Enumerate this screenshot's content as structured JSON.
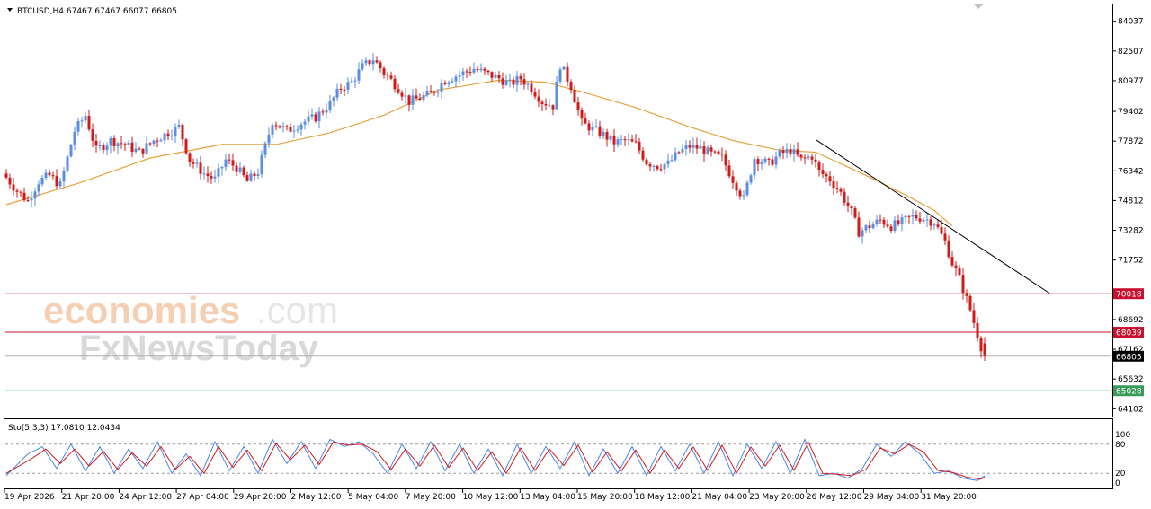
{
  "header": {
    "symbol_line": "BTCUSD,H4  67467 67467 66077 66805"
  },
  "watermark": {
    "brand_a": "economies",
    "brand_b": ".com",
    "brand_c": "FxNewsToday"
  },
  "stoch": {
    "label": "Sto(5,3,3) 17.0810 12.0434",
    "levels": [
      "100",
      "80",
      "20",
      "0"
    ]
  },
  "colors": {
    "bull": "#5b8ee0",
    "bear": "#d11a1a",
    "ma": "#e6a23c",
    "resistance": "#c8102e",
    "support": "#3a9a5b",
    "last_price": "#000000"
  },
  "chart_data": {
    "type": "candlestick",
    "title": "",
    "y_ticks": [
      84037,
      82507,
      80977,
      79402,
      77872,
      76342,
      74812,
      73282,
      71752,
      68692,
      67162,
      65632,
      64102
    ],
    "x_ticks": [
      "19 Apr 2026",
      "21 Apr 20:00",
      "24 Apr 12:00",
      "27 Apr 04:00",
      "29 Apr 20:00",
      "2 May 12:00",
      "5 May 04:00",
      "7 May 20:00",
      "10 May 12:00",
      "13 May 04:00",
      "15 May 20:00",
      "18 May 12:00",
      "21 May 04:00",
      "23 May 20:00",
      "26 May 12:00",
      "29 May 04:00",
      "31 May 20:00"
    ],
    "ylim": [
      63700,
      84900
    ],
    "price_labels": [
      {
        "label": "70018",
        "value": 70018,
        "kind": "resistance"
      },
      {
        "label": "68039",
        "value": 68039,
        "kind": "resistance"
      },
      {
        "label": "66805",
        "value": 66805,
        "kind": "last"
      },
      {
        "label": "65028",
        "value": 65028,
        "kind": "support"
      }
    ],
    "trendline": {
      "from": {
        "bar": 225,
        "price": 77950
      },
      "to": {
        "bar": 290,
        "price": 70050
      }
    },
    "close_path": [
      [
        0,
        76000
      ],
      [
        3,
        75300
      ],
      [
        6,
        74800
      ],
      [
        9,
        75800
      ],
      [
        12,
        76100
      ],
      [
        15,
        75600
      ],
      [
        19,
        78400
      ],
      [
        22,
        79200
      ],
      [
        25,
        77400
      ],
      [
        29,
        77900
      ],
      [
        33,
        77700
      ],
      [
        37,
        77300
      ],
      [
        41,
        77900
      ],
      [
        45,
        78300
      ],
      [
        48,
        78600
      ],
      [
        51,
        76900
      ],
      [
        55,
        76200
      ],
      [
        58,
        75900
      ],
      [
        61,
        76900
      ],
      [
        64,
        76500
      ],
      [
        67,
        75800
      ],
      [
        70,
        76300
      ],
      [
        74,
        78900
      ],
      [
        78,
        78400
      ],
      [
        82,
        78800
      ],
      [
        86,
        79100
      ],
      [
        90,
        79800
      ],
      [
        93,
        80600
      ],
      [
        96,
        80900
      ],
      [
        99,
        81700
      ],
      [
        102,
        82100
      ],
      [
        105,
        81400
      ],
      [
        109,
        80600
      ],
      [
        112,
        79900
      ],
      [
        115,
        80100
      ],
      [
        118,
        80300
      ],
      [
        122,
        81000
      ],
      [
        126,
        81300
      ],
      [
        130,
        81600
      ],
      [
        134,
        81300
      ],
      [
        137,
        81100
      ],
      [
        140,
        80800
      ],
      [
        143,
        81100
      ],
      [
        146,
        80600
      ],
      [
        149,
        79900
      ],
      [
        152,
        79700
      ],
      [
        154,
        81800
      ],
      [
        157,
        80700
      ],
      [
        160,
        78800
      ],
      [
        163,
        78500
      ],
      [
        166,
        78200
      ],
      [
        169,
        77800
      ],
      [
        172,
        77900
      ],
      [
        175,
        77700
      ],
      [
        178,
        76800
      ],
      [
        181,
        76600
      ],
      [
        184,
        76700
      ],
      [
        187,
        77300
      ],
      [
        190,
        77600
      ],
      [
        193,
        77500
      ],
      [
        196,
        77200
      ],
      [
        199,
        77000
      ],
      [
        202,
        75900
      ],
      [
        205,
        74900
      ],
      [
        208,
        77000
      ],
      [
        212,
        76700
      ],
      [
        215,
        77200
      ],
      [
        218,
        77400
      ],
      [
        221,
        76900
      ],
      [
        224,
        77100
      ],
      [
        226,
        76300
      ],
      [
        229,
        75900
      ],
      [
        232,
        75200
      ],
      [
        235,
        74200
      ],
      [
        237,
        73200
      ],
      [
        240,
        73500
      ],
      [
        243,
        73800
      ],
      [
        246,
        73500
      ],
      [
        249,
        73700
      ],
      [
        252,
        74000
      ],
      [
        255,
        73900
      ],
      [
        258,
        73700
      ],
      [
        261,
        72700
      ],
      [
        263,
        71600
      ],
      [
        265,
        70800
      ],
      [
        268,
        69200
      ],
      [
        270,
        67900
      ],
      [
        271,
        67300
      ],
      [
        272,
        66805
      ]
    ],
    "ma_path": [
      [
        0,
        74600
      ],
      [
        20,
        75700
      ],
      [
        40,
        77000
      ],
      [
        60,
        77700
      ],
      [
        75,
        77700
      ],
      [
        90,
        78300
      ],
      [
        105,
        79200
      ],
      [
        120,
        80500
      ],
      [
        137,
        81000
      ],
      [
        150,
        80900
      ],
      [
        162,
        80300
      ],
      [
        175,
        79600
      ],
      [
        190,
        78600
      ],
      [
        202,
        77900
      ],
      [
        215,
        77400
      ],
      [
        225,
        77300
      ],
      [
        238,
        76200
      ],
      [
        250,
        75100
      ],
      [
        258,
        74300
      ],
      [
        263,
        73500
      ]
    ],
    "stoch_k_path": [
      [
        0,
        15
      ],
      [
        6,
        60
      ],
      [
        10,
        75
      ],
      [
        14,
        30
      ],
      [
        18,
        80
      ],
      [
        22,
        25
      ],
      [
        26,
        75
      ],
      [
        30,
        20
      ],
      [
        34,
        70
      ],
      [
        38,
        30
      ],
      [
        42,
        85
      ],
      [
        46,
        20
      ],
      [
        50,
        60
      ],
      [
        54,
        15
      ],
      [
        58,
        85
      ],
      [
        62,
        25
      ],
      [
        66,
        75
      ],
      [
        70,
        20
      ],
      [
        74,
        90
      ],
      [
        78,
        40
      ],
      [
        82,
        85
      ],
      [
        86,
        30
      ],
      [
        90,
        90
      ],
      [
        94,
        75
      ],
      [
        98,
        85
      ],
      [
        102,
        60
      ],
      [
        106,
        20
      ],
      [
        110,
        80
      ],
      [
        114,
        30
      ],
      [
        118,
        85
      ],
      [
        122,
        25
      ],
      [
        126,
        80
      ],
      [
        130,
        20
      ],
      [
        134,
        70
      ],
      [
        138,
        15
      ],
      [
        142,
        80
      ],
      [
        146,
        20
      ],
      [
        150,
        75
      ],
      [
        154,
        30
      ],
      [
        158,
        85
      ],
      [
        162,
        15
      ],
      [
        166,
        70
      ],
      [
        170,
        20
      ],
      [
        174,
        75
      ],
      [
        178,
        15
      ],
      [
        182,
        75
      ],
      [
        186,
        25
      ],
      [
        190,
        80
      ],
      [
        194,
        20
      ],
      [
        198,
        85
      ],
      [
        202,
        15
      ],
      [
        206,
        80
      ],
      [
        210,
        30
      ],
      [
        214,
        85
      ],
      [
        218,
        20
      ],
      [
        222,
        90
      ],
      [
        226,
        15
      ],
      [
        230,
        20
      ],
      [
        234,
        10
      ],
      [
        238,
        30
      ],
      [
        242,
        80
      ],
      [
        246,
        55
      ],
      [
        250,
        85
      ],
      [
        254,
        60
      ],
      [
        258,
        20
      ],
      [
        262,
        25
      ],
      [
        266,
        10
      ],
      [
        270,
        5
      ],
      [
        272,
        15
      ]
    ],
    "stoch_d_path": [
      [
        0,
        20
      ],
      [
        7,
        50
      ],
      [
        11,
        70
      ],
      [
        15,
        40
      ],
      [
        19,
        70
      ],
      [
        23,
        35
      ],
      [
        27,
        65
      ],
      [
        31,
        28
      ],
      [
        35,
        62
      ],
      [
        39,
        35
      ],
      [
        43,
        75
      ],
      [
        47,
        28
      ],
      [
        51,
        55
      ],
      [
        55,
        20
      ],
      [
        59,
        75
      ],
      [
        63,
        32
      ],
      [
        67,
        68
      ],
      [
        71,
        25
      ],
      [
        75,
        82
      ],
      [
        79,
        48
      ],
      [
        83,
        78
      ],
      [
        87,
        38
      ],
      [
        91,
        85
      ],
      [
        95,
        78
      ],
      [
        99,
        80
      ],
      [
        103,
        65
      ],
      [
        107,
        28
      ],
      [
        111,
        70
      ],
      [
        115,
        35
      ],
      [
        119,
        78
      ],
      [
        123,
        32
      ],
      [
        127,
        72
      ],
      [
        131,
        26
      ],
      [
        135,
        64
      ],
      [
        139,
        20
      ],
      [
        143,
        72
      ],
      [
        147,
        26
      ],
      [
        151,
        70
      ],
      [
        155,
        36
      ],
      [
        159,
        78
      ],
      [
        163,
        22
      ],
      [
        167,
        64
      ],
      [
        171,
        25
      ],
      [
        175,
        68
      ],
      [
        179,
        20
      ],
      [
        183,
        68
      ],
      [
        187,
        30
      ],
      [
        191,
        74
      ],
      [
        195,
        26
      ],
      [
        199,
        78
      ],
      [
        203,
        20
      ],
      [
        207,
        74
      ],
      [
        211,
        35
      ],
      [
        215,
        78
      ],
      [
        219,
        26
      ],
      [
        223,
        84
      ],
      [
        227,
        20
      ],
      [
        231,
        18
      ],
      [
        235,
        15
      ],
      [
        239,
        28
      ],
      [
        243,
        72
      ],
      [
        247,
        60
      ],
      [
        251,
        80
      ],
      [
        255,
        64
      ],
      [
        259,
        26
      ],
      [
        263,
        22
      ],
      [
        267,
        12
      ],
      [
        271,
        8
      ],
      [
        272,
        12
      ]
    ]
  }
}
